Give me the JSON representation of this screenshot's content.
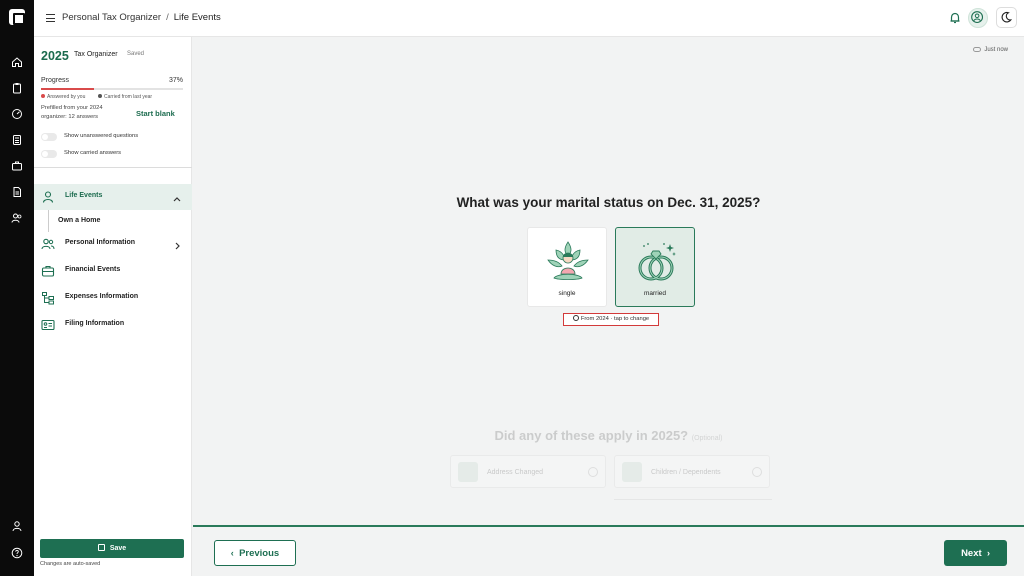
{
  "topbar": {
    "breadcrumb": [
      "Personal Tax Organizer",
      "Life Events"
    ],
    "icons": [
      "menu-icon",
      "bell-icon",
      "user-circle-icon",
      "moon-icon"
    ]
  },
  "rail": {
    "icons": [
      "logo-icon",
      "home-icon",
      "clipboard-icon",
      "gauge-icon",
      "calculator-icon",
      "briefcase-icon",
      "document-icon",
      "users-icon",
      "user-icon",
      "help-icon"
    ]
  },
  "sidebar": {
    "year": "2025",
    "organizer_label": "Tax Organizer",
    "saved_label": "Saved",
    "progress_label": "Progress",
    "progress_value": "37%",
    "progress_fraction": 0.37,
    "legend_answered": "Answered by you",
    "legend_carried": "Carried from last year",
    "prefilled_text": "Prefilled from your 2024 organizer: 12 answers",
    "start_blank": "Start blank",
    "toggle_unanswered": "Show unanswered questions",
    "toggle_carried": "Show carried answers",
    "nav": [
      {
        "label": "Life Events",
        "icon": "user-icon"
      },
      {
        "label": "Own a Home"
      },
      {
        "label": "Personal Information",
        "icon": "users-icon"
      },
      {
        "label": "Financial Events",
        "icon": "briefcase-icon"
      },
      {
        "label": "Expenses Information",
        "icon": "tree-icon"
      },
      {
        "label": "Filing Information",
        "icon": "id-card-icon"
      }
    ],
    "save_label": "Save",
    "autosave_note": "Changes are auto-saved"
  },
  "main": {
    "status": "Just now",
    "question": "What was your marital status on Dec. 31, 2025?",
    "options": [
      {
        "label": "single",
        "selected": false
      },
      {
        "label": "married",
        "selected": true
      }
    ],
    "from_tag": "From 2024 · tap to change",
    "question2": "Did any of these apply in 2025?",
    "question2_optional": "(Optional)",
    "events": [
      {
        "label": "Address Changed"
      },
      {
        "label": "Children / Dependents"
      }
    ]
  },
  "footer": {
    "previous": "Previous",
    "next": "Next"
  },
  "colors": {
    "accent": "#1e6f52",
    "rail": "#0b0b0b",
    "highlight_border": "#d33a3a",
    "progress_fill": "#d94b4b"
  }
}
